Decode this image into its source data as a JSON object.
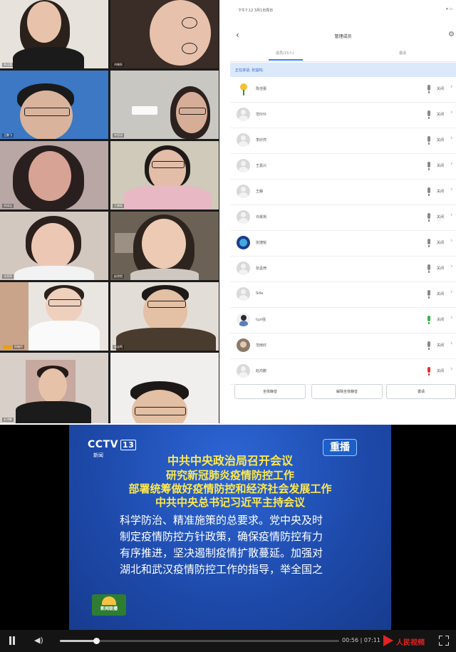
{
  "grid": {
    "tiles": [
      {
        "name": "陈佳蕾"
      },
      {
        "name": "刘晓彤"
      },
      {
        "name": "王鹏飞"
      },
      {
        "name": "李思琪"
      },
      {
        "name": "刘冰洁"
      },
      {
        "name": "王晓雨"
      },
      {
        "name": "张萌萌"
      },
      {
        "name": "赵欣悦"
      },
      {
        "name": "徐晓丹"
      },
      {
        "name": "张益鸣"
      },
      {
        "name": "赵鸿鹏"
      },
      {
        "name": ""
      }
    ]
  },
  "phone": {
    "status_time": "下午7:12  3月1日周日",
    "status_right": "▾ ▭",
    "back_icon": "‹",
    "title": "管理成员",
    "settings_icon": "⚙",
    "tabs": [
      "成员(15人)",
      "邀请"
    ],
    "speaking": "正在讲话: 张益鸣;",
    "members": [
      {
        "name": "陈佳蕾",
        "state": "关闭",
        "mic": "muted"
      },
      {
        "name": "范玲玲",
        "state": "关闭",
        "mic": "muted"
      },
      {
        "name": "李欣然",
        "state": "关闭",
        "mic": "muted"
      },
      {
        "name": "王嘉兴",
        "state": "关闭",
        "mic": "muted"
      },
      {
        "name": "王静",
        "state": "关闭",
        "mic": "muted"
      },
      {
        "name": "许晨玥",
        "state": "关闭",
        "mic": "muted"
      },
      {
        "name": "张捷锐",
        "state": "关闭",
        "mic": "muted"
      },
      {
        "name": "张孟琦",
        "state": "关闭",
        "mic": "muted"
      },
      {
        "name": "Silie",
        "state": "关闭",
        "mic": "muted"
      },
      {
        "name": "tyzi强",
        "state": "关闭",
        "mic": "speaking"
      },
      {
        "name": "范雨欣",
        "state": "关闭",
        "mic": "muted"
      },
      {
        "name": "赵鸿鹏",
        "state": "关闭",
        "mic": "red"
      }
    ],
    "buttons": {
      "mute_all": "全体静音",
      "unmute_all": "解除全体静音",
      "invite": "邀请"
    },
    "chevron_icon": "›"
  },
  "video": {
    "channel_logo": "CCTV",
    "channel_number": "13",
    "channel_sub": "新闻",
    "replay_badge": "重播",
    "headlines": [
      "中共中央政治局召开会议",
      "研究新冠肺炎疫情防控工作",
      "部署统筹做好疫情防控和经济社会发展工作",
      "中共中央总书记习近平主持会议"
    ],
    "body_lines": [
      "科学防治、精准施策的总要求。党中央及时",
      "制定疫情防控方针政策，确保疫情防控有力",
      "有序推进，坚决遏制疫情扩散蔓延。加强对",
      "湖北和武汉疫情防控工作的指导，举全国之"
    ],
    "program_logo": "新闻联播",
    "controls": {
      "volume_icon": "◀)",
      "time": "00:56 | 07:11",
      "progress": 0.13,
      "brand": "人民视频"
    },
    "colors": {
      "screen_blue": "#1f4fb8",
      "headline_yellow": "#ffe94a",
      "brand_red": "#e02424"
    }
  }
}
